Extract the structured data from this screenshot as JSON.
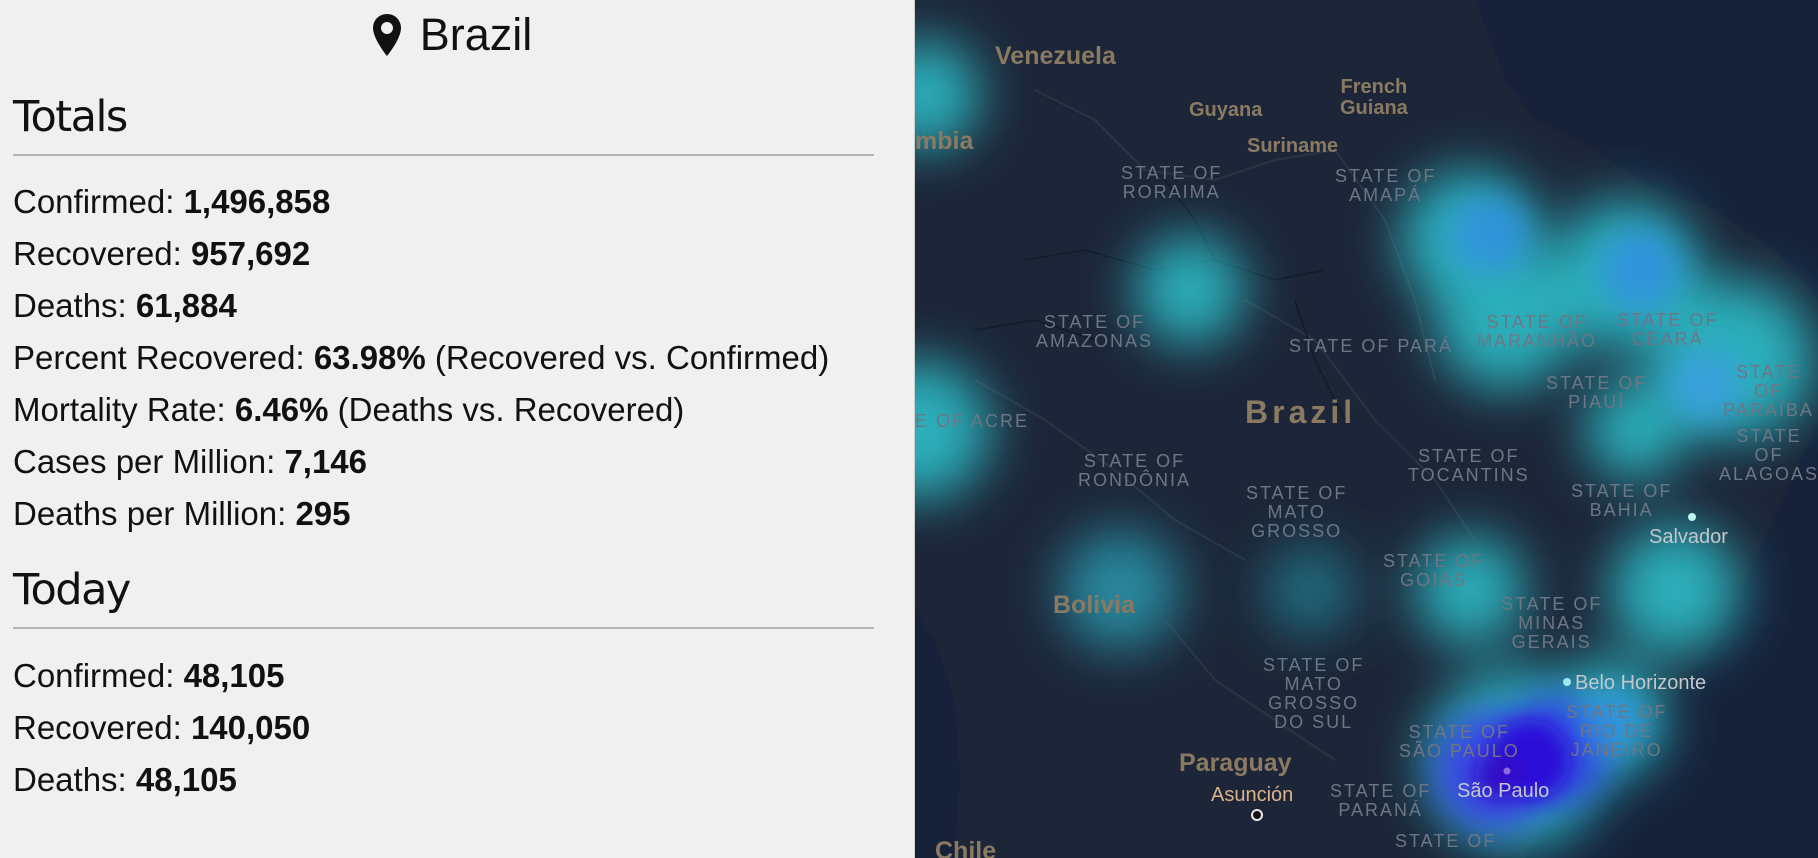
{
  "country": {
    "name": "Brazil",
    "icon": "map-pin-icon"
  },
  "totals": {
    "heading": "Totals",
    "rows": [
      {
        "label": "Confirmed: ",
        "value": "1,496,858",
        "note": ""
      },
      {
        "label": "Recovered: ",
        "value": "957,692",
        "note": ""
      },
      {
        "label": "Deaths: ",
        "value": "61,884",
        "note": ""
      },
      {
        "label": "Percent Recovered: ",
        "value": "63.98%",
        "note": " (Recovered vs. Confirmed)"
      },
      {
        "label": "Mortality Rate: ",
        "value": "6.46%",
        "note": " (Deaths vs. Recovered)"
      },
      {
        "label": "Cases per Million: ",
        "value": "7,146",
        "note": ""
      },
      {
        "label": "Deaths per Million: ",
        "value": "295",
        "note": ""
      }
    ]
  },
  "today": {
    "heading": "Today",
    "rows": [
      {
        "label": "Confirmed: ",
        "value": "48,105",
        "note": ""
      },
      {
        "label": "Recovered: ",
        "value": "140,050",
        "note": ""
      },
      {
        "label": "Deaths: ",
        "value": "48,105",
        "note": ""
      }
    ]
  },
  "map": {
    "countries": {
      "venezuela": "Venezuela",
      "colombia_partial": "mbia",
      "guyana": "Guyana",
      "french_guiana": "French\nGuiana",
      "suriname": "Suriname",
      "brazil": "Brazil",
      "bolivia": "Bolivia",
      "paraguay": "Paraguay",
      "chile": "Chile"
    },
    "states": {
      "roraima": "STATE OF\nRORAIMA",
      "amapa": "STATE OF\nAMAPÁ",
      "amazonas": "STATE OF\nAMAZONAS",
      "para": "STATE OF PARÁ",
      "maranhao": "STATE OF\nMARANHÃO",
      "ceara": "STATE OF\nCEARÁ",
      "paraiba": "STATE OF\nPARAÍBA",
      "alagoas": "STATE OF\nALAGOAS",
      "piaui": "STATE OF\nPIAUÍ",
      "acre": "E OF ACRE",
      "rondonia": "STATE OF\nRONDÔNIA",
      "mato_grosso": "STATE OF\nMATO\nGROSSO",
      "tocantins": "STATE OF\nTOCANTINS",
      "bahia": "STATE OF\nBAHIA",
      "goias": "STATE OF\nGOIÁS",
      "minas_gerais": "STATE OF\nMINAS\nGERAIS",
      "mato_grosso_do_sul": "STATE OF\nMATO\nGROSSO\nDO SUL",
      "sao_paulo": "STATE OF\nSÃO PAULO",
      "rio_de_janeiro": "STATE OF\nRIO DE\nJANEIRO",
      "parana": "STATE OF\nPARANÁ",
      "santa_catarina": "STATE OF"
    },
    "cities": {
      "salvador": "Salvador",
      "belo_horizonte": "Belo Horizonte",
      "sao_paulo": "São Paulo",
      "asuncion": "Asunción"
    }
  },
  "colors": {
    "panel_bg": "#f0f0f0",
    "map_bg": "#1b2535",
    "heat_low": "#3fe0e6",
    "heat_mid": "#2a8fe6",
    "heat_high": "#2a0fe0"
  }
}
